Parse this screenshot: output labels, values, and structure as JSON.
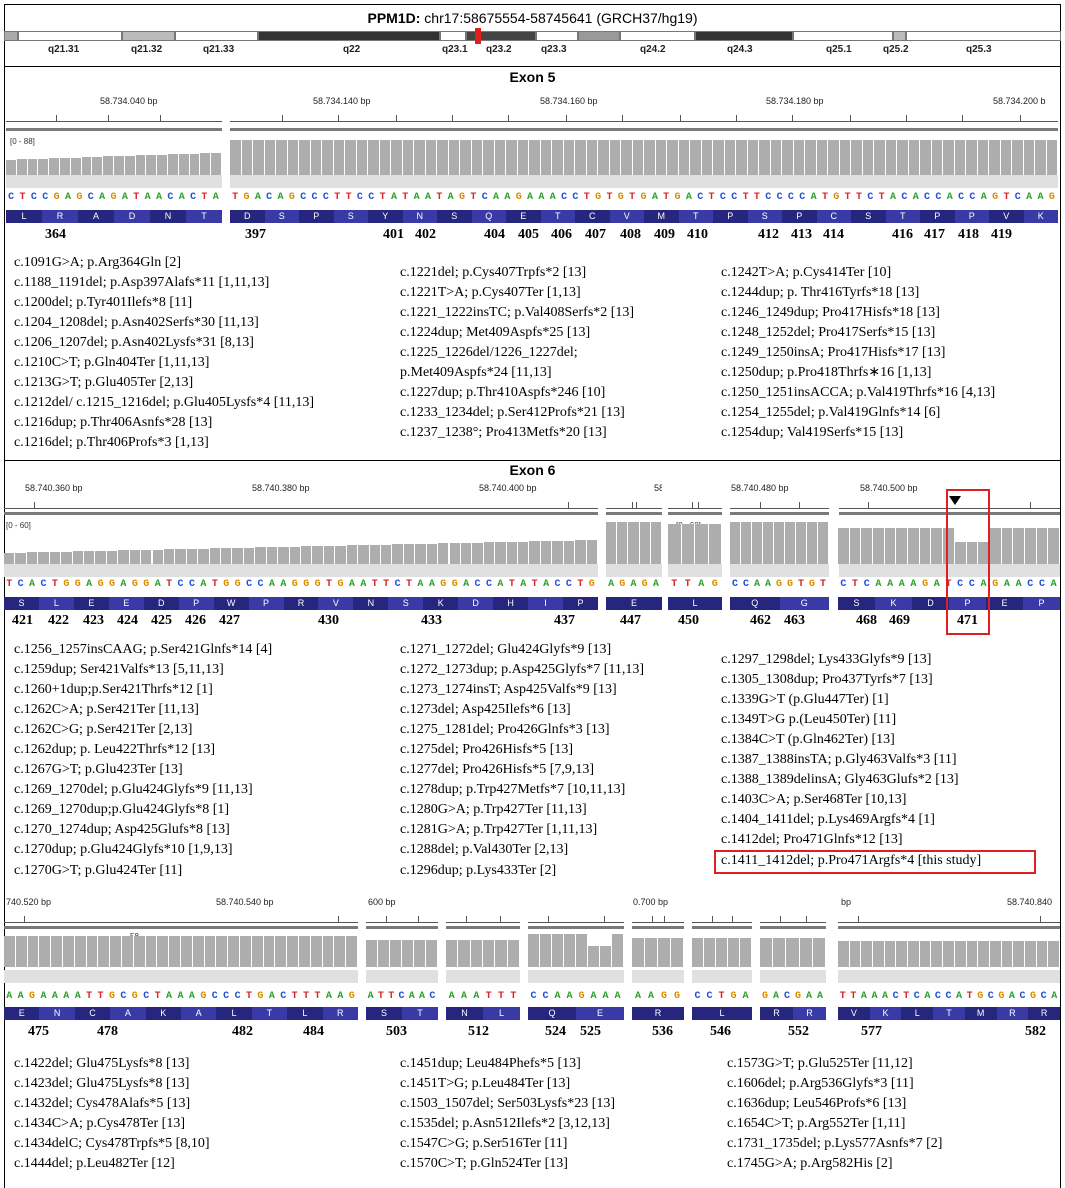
{
  "header": {
    "gene": "PPM1D:",
    "coords": "chr17:58675554-58745641 (GRCH37/hg19)"
  },
  "bands": [
    "q21.31",
    "q21.32",
    "q21.33",
    "q22",
    "q23.1",
    "q23.2",
    "q23.3",
    "q24.2",
    "q24.3",
    "q25.1",
    "q25.2",
    "q25.3"
  ],
  "exon5": {
    "title": "Exon 5",
    "coverage_label": "[0 - 88]",
    "ruler": [
      "58.734.040 bp",
      "58.734.140 bp",
      "58.734.160 bp",
      "58.734.180 bp",
      "58.734.200 b"
    ],
    "seq_a": "CTCCGAGCAGATAACACTA",
    "seq_b": "TGACAGCCCTTCCTATAATAGTCAAGAAACCTGTGTGATGACTCCTTCCCCATGTTCTACACCACCAGTCAAG",
    "aa_a": [
      "L",
      "R",
      "A",
      "D",
      "N",
      "T"
    ],
    "aa_b": [
      "D",
      "S",
      "P",
      "S",
      "Y",
      "N",
      "S",
      "Q",
      "E",
      "T",
      "C",
      "V",
      "M",
      "T",
      "P",
      "S",
      "P",
      "C",
      "S",
      "T",
      "P",
      "P",
      "V",
      "K"
    ],
    "numbers": [
      "364",
      "397",
      "401",
      "402",
      "404",
      "405",
      "406",
      "407",
      "408",
      "409",
      "410",
      "412",
      "413",
      "414",
      "416",
      "417",
      "418",
      "419"
    ],
    "col1": [
      "c.1091G>A; p.Arg364Gln [2]",
      "c.1188_1191del; p.Asp397Alafs*11 [1,11,13]",
      "c.1200del; p.Tyr401Ilefs*8 [11]",
      "c.1204_1208del; p.Asn402Serfs*30 [11,13]",
      "c.1206_1207del; p.Asn402Lysfs*31 [8,13]",
      "c.1210C>T; p.Gln404Ter [1,11,13]",
      "c.1213G>T; p.Glu405Ter [2,13]",
      "c.1212del/ c.1215_1216del; p.Glu405Lysfs*4 [11,13]",
      "c.1216dup; p.Thr406Asnfs*28 [13]",
      "c.1216del; p.Thr406Profs*3 [1,13]"
    ],
    "col2": [
      "c.1221del; p.Cys407Trpfs*2 [13]",
      "c.1221T>A; p.Cys407Ter [1,13]",
      "c.1221_1222insTC; p.Val408Serfs*2 [13]",
      "c.1224dup; Met409Aspfs*25 [13]",
      "c.1225_1226del/1226_1227del;",
      "p.Met409Aspfs*24 [11,13]",
      "c.1227dup; p.Thr410Aspfs*246 [10]",
      "c.1233_1234del; p.Ser412Profs*21 [13]",
      "c.1237_1238°; Pro413Metfs*20 [13]"
    ],
    "col3": [
      "c.1242T>A; p.Cys414Ter [10]",
      "c.1244dup; p. Thr416Tyrfs*18 [13]",
      "c.1246_1249dup; Pro417Hisfs*18 [13]",
      "c.1248_1252del; Pro417Serfs*15 [13]",
      "c.1249_1250insA; Pro417Hisfs*17 [13]",
      "c.1250dup; p.Pro418Thrfs∗16 [1,13]",
      "c.1250_1251insACCA; p.Val419Thrfs*16 [4,13]",
      "c.1254_1255del; p.Val419Glnfs*14 [6]",
      "c.1254dup; Val419Serfs*15 [13]"
    ]
  },
  "exon6": {
    "title": "Exon 6",
    "coverage_label": "[0 - 60]",
    "coverage_label2": "[0 - 60]",
    "ruler": [
      "58.740.360 bp",
      "58.740.380 bp",
      "58.740.400 bp",
      "58",
      "58.740.480 bp",
      "58.740.500 bp"
    ],
    "seq_a": "TCACTGGAGGAGGATCCATGGCCAAGGGTGAATTCTAAGGACCATATACCTG",
    "seq_b": "AGAGA",
    "seq_c": "TTAG",
    "seq_d": "CCAAGGTGT",
    "seq_e": "CTCAAAAGATCCAGAACCA",
    "aa_a": [
      "S",
      "L",
      "E",
      "E",
      "D",
      "P",
      "W",
      "P",
      "R",
      "V",
      "N",
      "S",
      "K",
      "D",
      "H",
      "I",
      "P"
    ],
    "aa_b": [
      "E"
    ],
    "aa_c": [
      "L"
    ],
    "aa_d": [
      "Q",
      "G"
    ],
    "aa_e": [
      "S",
      "K",
      "D",
      "P",
      "E",
      "P"
    ],
    "numbers": [
      "421",
      "422",
      "423",
      "424",
      "425",
      "426",
      "427",
      "430",
      "433",
      "437",
      "447",
      "450",
      "462",
      "463",
      "468",
      "469",
      "471"
    ],
    "col1": [
      "c.1256_1257insCAAG; p.Ser421Glnfs*14 [4]",
      "c.1259dup; Ser421Valfs*13 [5,11,13]",
      "c.1260+1dup;p.Ser421Thrfs*12 [1]",
      "c.1262C>A; p.Ser421Ter [11,13]",
      "c.1262C>G; p.Ser421Ter [2,13]",
      "c.1262dup; p. Leu422Thrfs*12 [13]",
      "c.1267G>T; p.Glu423Ter [13]",
      "c.1269_1270del; p.Glu424Glyfs*9 [11,13]",
      "c.1269_1270dup;p.Glu424Glyfs*8 [1]",
      "c.1270_1274dup; Asp425Glufs*8 [13]",
      "c.1270dup; p.Glu424Glyfs*10 [1,9,13]",
      "c.1270G>T; p.Glu424Ter [11]"
    ],
    "col2": [
      "c.1271_1272del; Glu424Glyfs*9 [13]",
      "c.1272_1273dup; p.Asp425Glyfs*7 [11,13]",
      "c.1273_1274insT; Asp425Valfs*9 [13]",
      "c.1273del; Asp425Ilefs*6 [13]",
      "c.1275_1281del; Pro426Glnfs*3 [13]",
      "c.1275del; Pro426Hisfs*5 [13]",
      "c.1277del; Pro426Hisfs*5 [7,9,13]",
      "c.1278dup; p.Trp427Metfs*7 [10,11,13]",
      "c.1280G>A; p.Trp427Ter [11,13]",
      "c.1281G>A; p.Trp427Ter [1,11,13]",
      "c.1288del; p.Val430Ter [2,13]",
      "c.1296dup; p.Lys433Ter [2]"
    ],
    "col3": [
      "c.1297_1298del; Lys433Glyfs*9 [13]",
      "c.1305_1308dup; Pro437Tyrfs*7 [13]",
      "c.1339G>T (p.Glu447Ter) [1]",
      "c.1349T>G p.(Leu450Ter) [11]",
      "c.1384C>T (p.Gln462Ter) [13]",
      "c.1387_1388insTA; p.Gly463Valfs*3 [11]",
      "c.1388_1389delinsA; Gly463Glufs*2 [13]",
      "c.1403C>A; p.Ser468Ter [10,13]",
      "c.1404_1411del; p.Lys469Argfs*4 [1]",
      "c.1412del; Pro471Glnfs*12 [13]"
    ],
    "highlight": "c.1411_1412del; p.Pro471Argfs*4 [this study]"
  },
  "exon6b": {
    "ruler": [
      "740.520 bp",
      "58.740.540 bp",
      "600 bp",
      "0.700 bp",
      "bp",
      "58.740.840"
    ],
    "coverage_label": "58",
    "seq_a": "AAGAAAATTGCGCTAAAGCCCTGACTTTAAG",
    "seq_b": "ATTCAAC",
    "seq_c": "AAATTT",
    "seq_d": "CCAAGAAA",
    "seq_e": "AAGG",
    "seq_f": "CCTGA",
    "seq_g": "GACGAA",
    "seq_h": "TTAAACTCACCATGCGACGCA",
    "aa_a": [
      "E",
      "N",
      "C",
      "A",
      "K",
      "A",
      "L",
      "T",
      "L",
      "R"
    ],
    "aa_b": [
      "S",
      "T"
    ],
    "aa_c": [
      "N",
      "L"
    ],
    "aa_d": [
      "Q",
      "E"
    ],
    "aa_e": [
      "R"
    ],
    "aa_f": [
      "L"
    ],
    "aa_g": [
      "R",
      "R"
    ],
    "aa_h": [
      "V",
      "K",
      "L",
      "T",
      "M",
      "R",
      "R"
    ],
    "numbers": [
      "475",
      "478",
      "482",
      "484",
      "503",
      "512",
      "524",
      "525",
      "536",
      "546",
      "552",
      "577",
      "582"
    ],
    "col1": [
      "c.1422del; Glu475Lysfs*8 [13]",
      "c.1423del; Glu475Lysfs*8 [13]",
      "c.1432del; Cys478Alafs*5 [13]",
      "c.1434C>A; p.Cys478Ter [13]",
      "c.1434delC; Cys478Trpfs*5 [8,10]",
      "c.1444del; p.Leu482Ter [12]"
    ],
    "col2": [
      "c.1451dup; Leu484Phefs*5 [13]",
      "c.1451T>G; p.Leu484Ter [13]",
      "c.1503_1507del; Ser503Lysfs*23 [13]",
      "c.1535del; p.Asn512Ilefs*2 [3,12,13]",
      "c.1547C>G; p.Ser516Ter [11]",
      "c.1570C>T; p.Gln524Ter [13]"
    ],
    "col3": [
      "c.1573G>T; p.Glu525Ter [11,12]",
      "c.1606del; p.Arg536Glyfs*3 [11]",
      "c.1636dup; Leu546Profs*6 [13]",
      "c.1654C>T; p.Arg552Ter [1,11]",
      "c.1731_1735del; p.Lys577Asnfs*7 [2]",
      "c.1745G>A; p.Arg582His [2]"
    ]
  },
  "colors": {
    "A": "#2ca02c",
    "C": "#1f4fd6",
    "G": "#d98c00",
    "T": "#d62728",
    "aa_bg": "#2b2b8c",
    "highlight": "#e02020",
    "coverage": "#adadad"
  }
}
